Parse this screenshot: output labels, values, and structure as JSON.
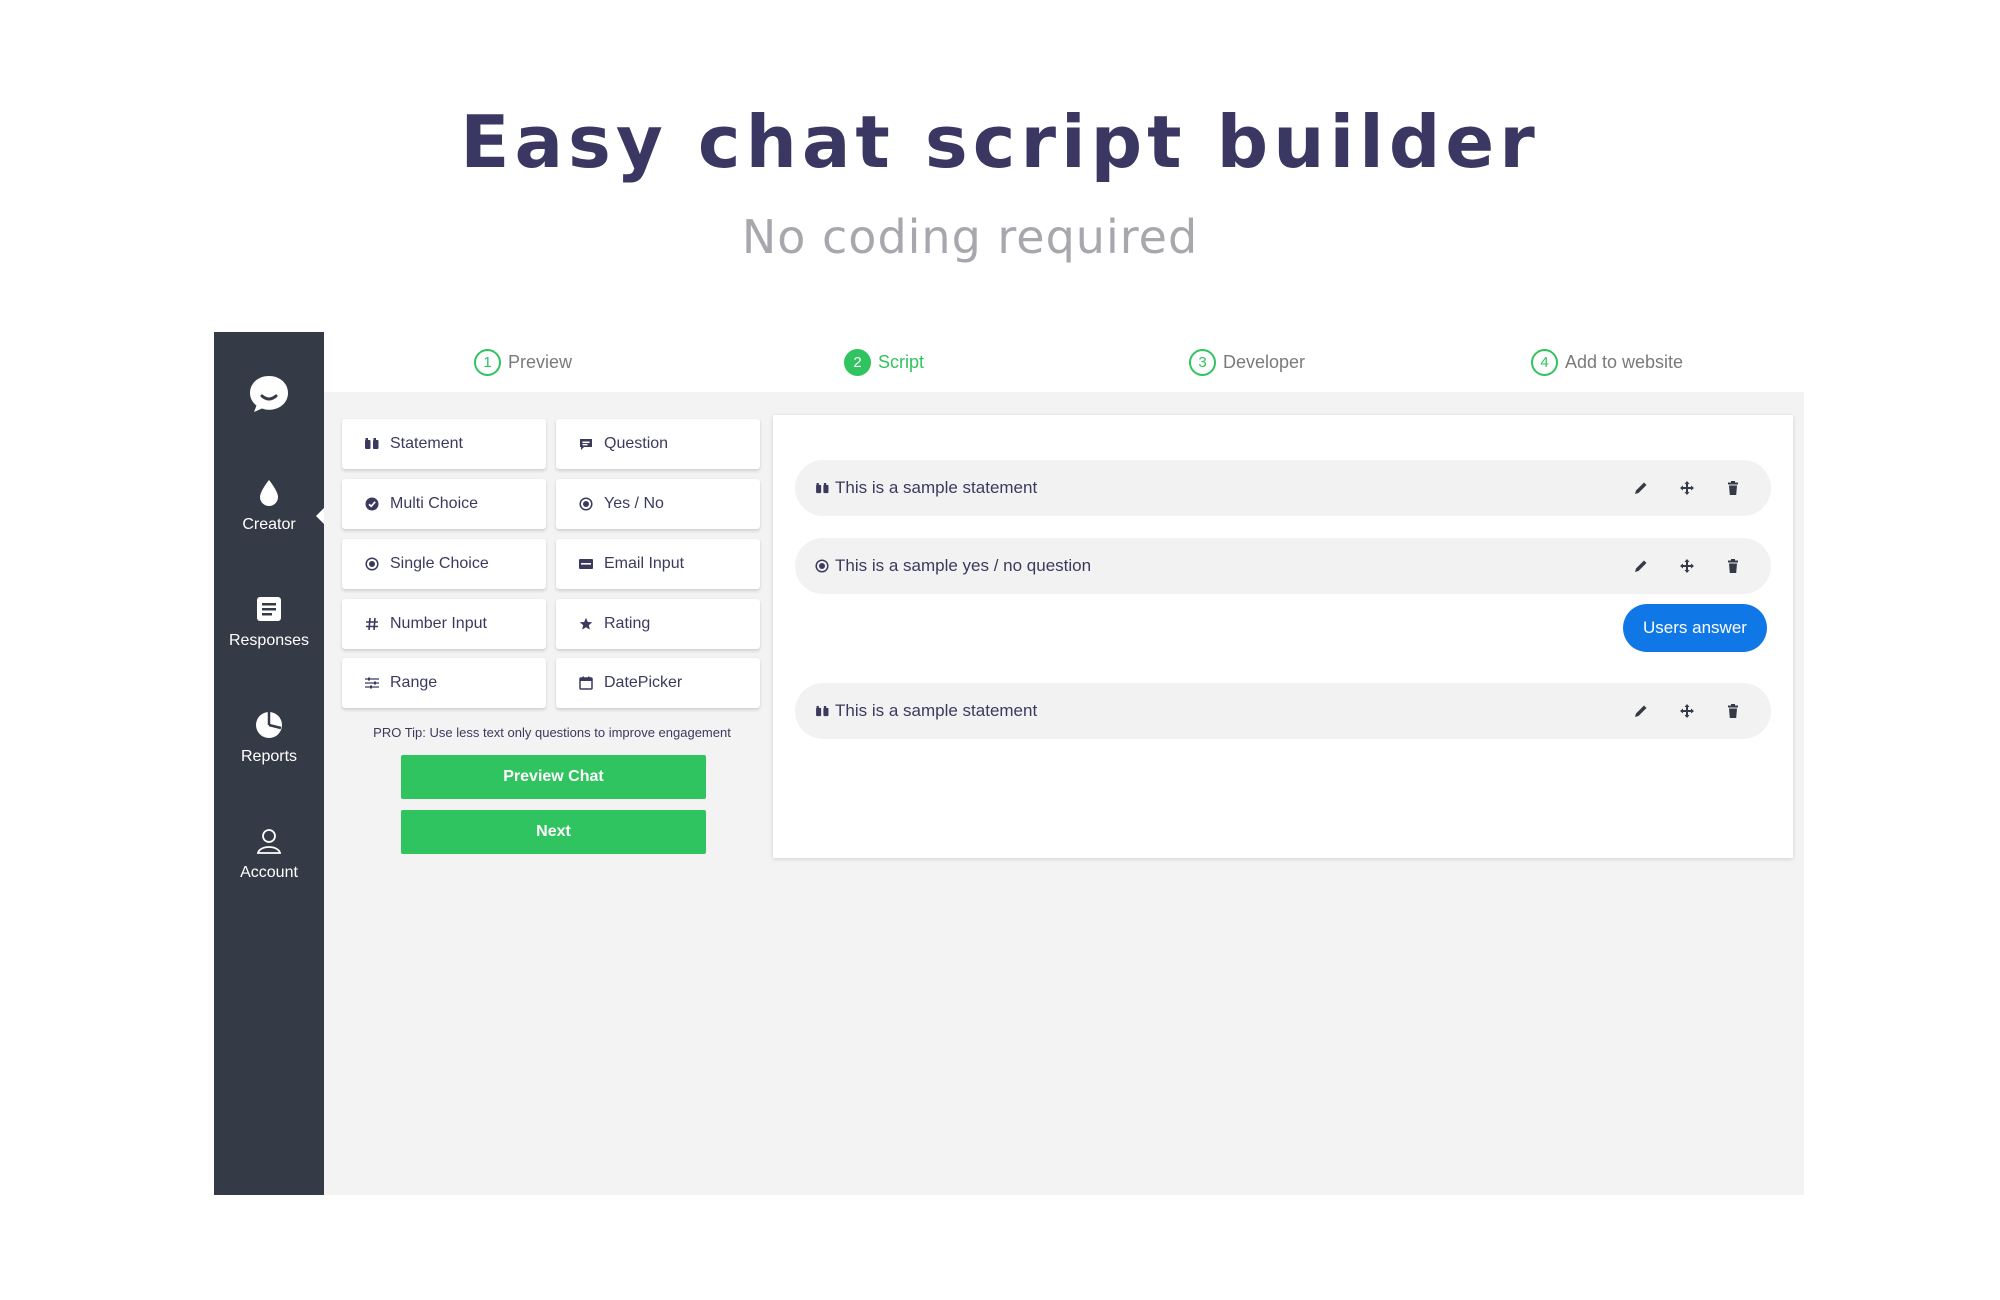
{
  "hero": {
    "title": "Easy chat script builder",
    "subtitle": "No coding required"
  },
  "sidebar": {
    "items": [
      {
        "label": "Creator",
        "icon": "drop-icon",
        "active": true
      },
      {
        "label": "Responses",
        "icon": "document-icon",
        "active": false
      },
      {
        "label": "Reports",
        "icon": "pie-chart-icon",
        "active": false
      },
      {
        "label": "Account",
        "icon": "user-icon",
        "active": false
      }
    ]
  },
  "steps": [
    {
      "num": "1",
      "label": "Preview",
      "active": false
    },
    {
      "num": "2",
      "label": "Script",
      "active": true
    },
    {
      "num": "3",
      "label": "Developer",
      "active": false
    },
    {
      "num": "4",
      "label": "Add to website",
      "active": false
    }
  ],
  "palette": {
    "items": [
      {
        "label": "Statement",
        "icon": "quote-icon"
      },
      {
        "label": "Question",
        "icon": "chat-bubble-icon"
      },
      {
        "label": "Multi Choice",
        "icon": "check-circle-icon"
      },
      {
        "label": "Yes / No",
        "icon": "radio-icon"
      },
      {
        "label": "Single Choice",
        "icon": "radio-icon"
      },
      {
        "label": "Email Input",
        "icon": "email-icon"
      },
      {
        "label": "Number Input",
        "icon": "hash-icon"
      },
      {
        "label": "Rating",
        "icon": "star-icon"
      },
      {
        "label": "Range",
        "icon": "sliders-icon"
      },
      {
        "label": "DatePicker",
        "icon": "calendar-icon"
      }
    ],
    "pro_tip": "PRO Tip: Use less text only questions to improve engagement",
    "preview_button": "Preview Chat",
    "next_button": "Next"
  },
  "script": {
    "rows": [
      {
        "text": "This is a sample statement",
        "icon": "quote-icon"
      },
      {
        "text": "This is a sample yes / no question",
        "icon": "radio-icon"
      },
      {
        "text": "This is a sample statement",
        "icon": "quote-icon"
      }
    ],
    "answer_label": "Users answer"
  },
  "colors": {
    "sidebar": "#343b46",
    "accent_green": "#2fc45f",
    "answer_blue": "#0f77e6",
    "title_text": "#3b3763"
  }
}
